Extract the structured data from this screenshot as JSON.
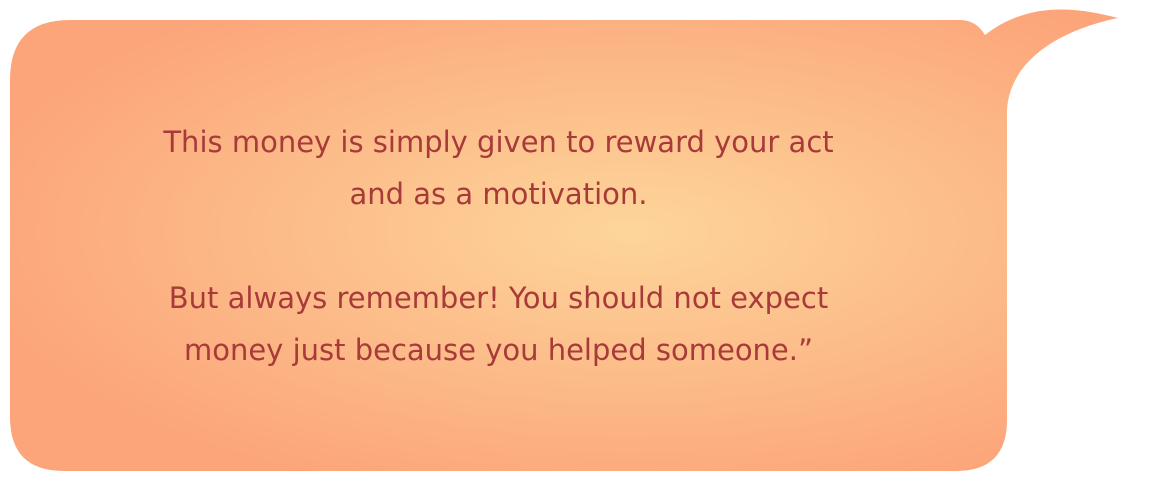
{
  "bubble": {
    "paragraphs": [
      "This money is simply given to reward your act\nand as a motivation.",
      "But always remember! You should not expect\nmoney just because you helped someone.”"
    ]
  },
  "colors": {
    "gradient_center": "#fdd59a",
    "gradient_edge": "#fca57a",
    "text": "#a83a3a",
    "background": "#ffffff"
  }
}
